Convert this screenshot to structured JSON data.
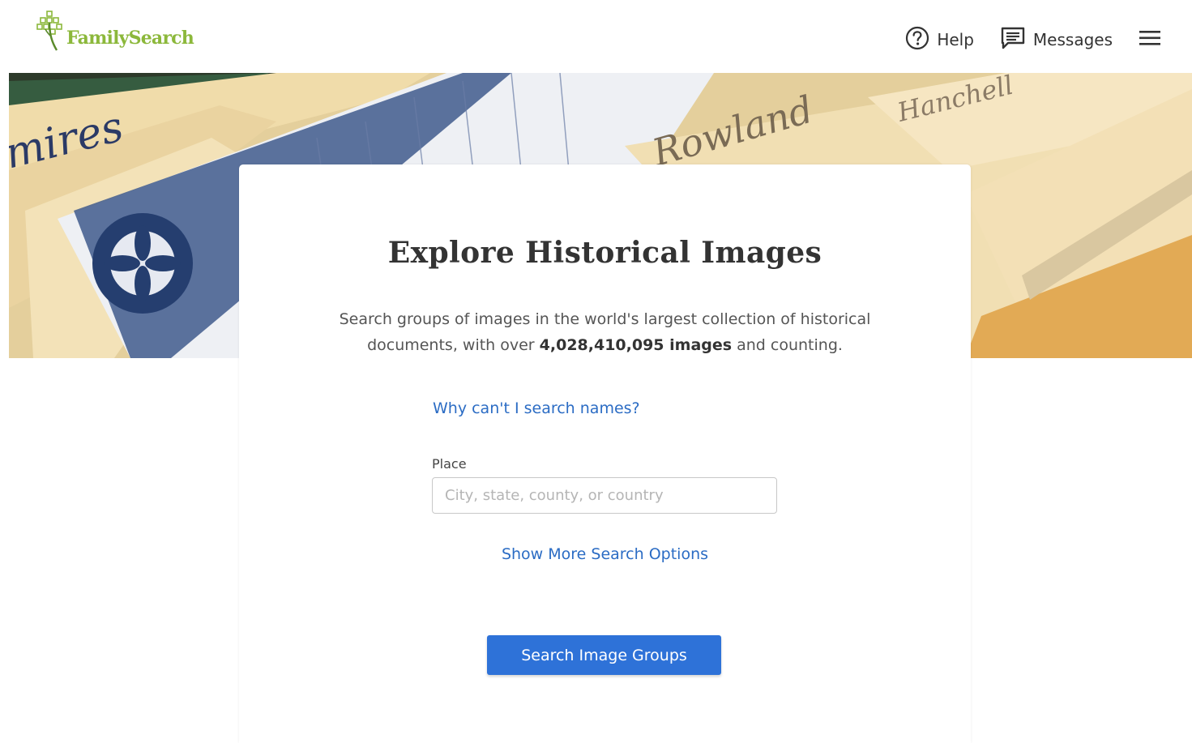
{
  "header": {
    "logo_text": "FamilySearch",
    "nav": {
      "help_label": "Help",
      "messages_label": "Messages"
    },
    "icons": [
      "family-tree-logo-icon",
      "help-circle-icon",
      "message-icon",
      "hamburger-menu-icon"
    ]
  },
  "hero": {
    "folder_labels": [
      "mires",
      "Rowland",
      "Hanchell"
    ]
  },
  "card": {
    "title": "Explore Historical Images",
    "description_before": "Search groups of images in the world's largest collection of historical documents, with over ",
    "description_count": "4,028,410,095 images",
    "description_after": " and counting.",
    "why_link": "Why can't I search names?",
    "place": {
      "label": "Place",
      "placeholder": "City, state, county, or country",
      "value": ""
    },
    "more_options_link": "Show More Search Options",
    "search_button": "Search Image Groups"
  },
  "colors": {
    "brand_green": "#8cb83b",
    "link_blue": "#2b6cc4",
    "button_blue": "#2e72d8"
  }
}
